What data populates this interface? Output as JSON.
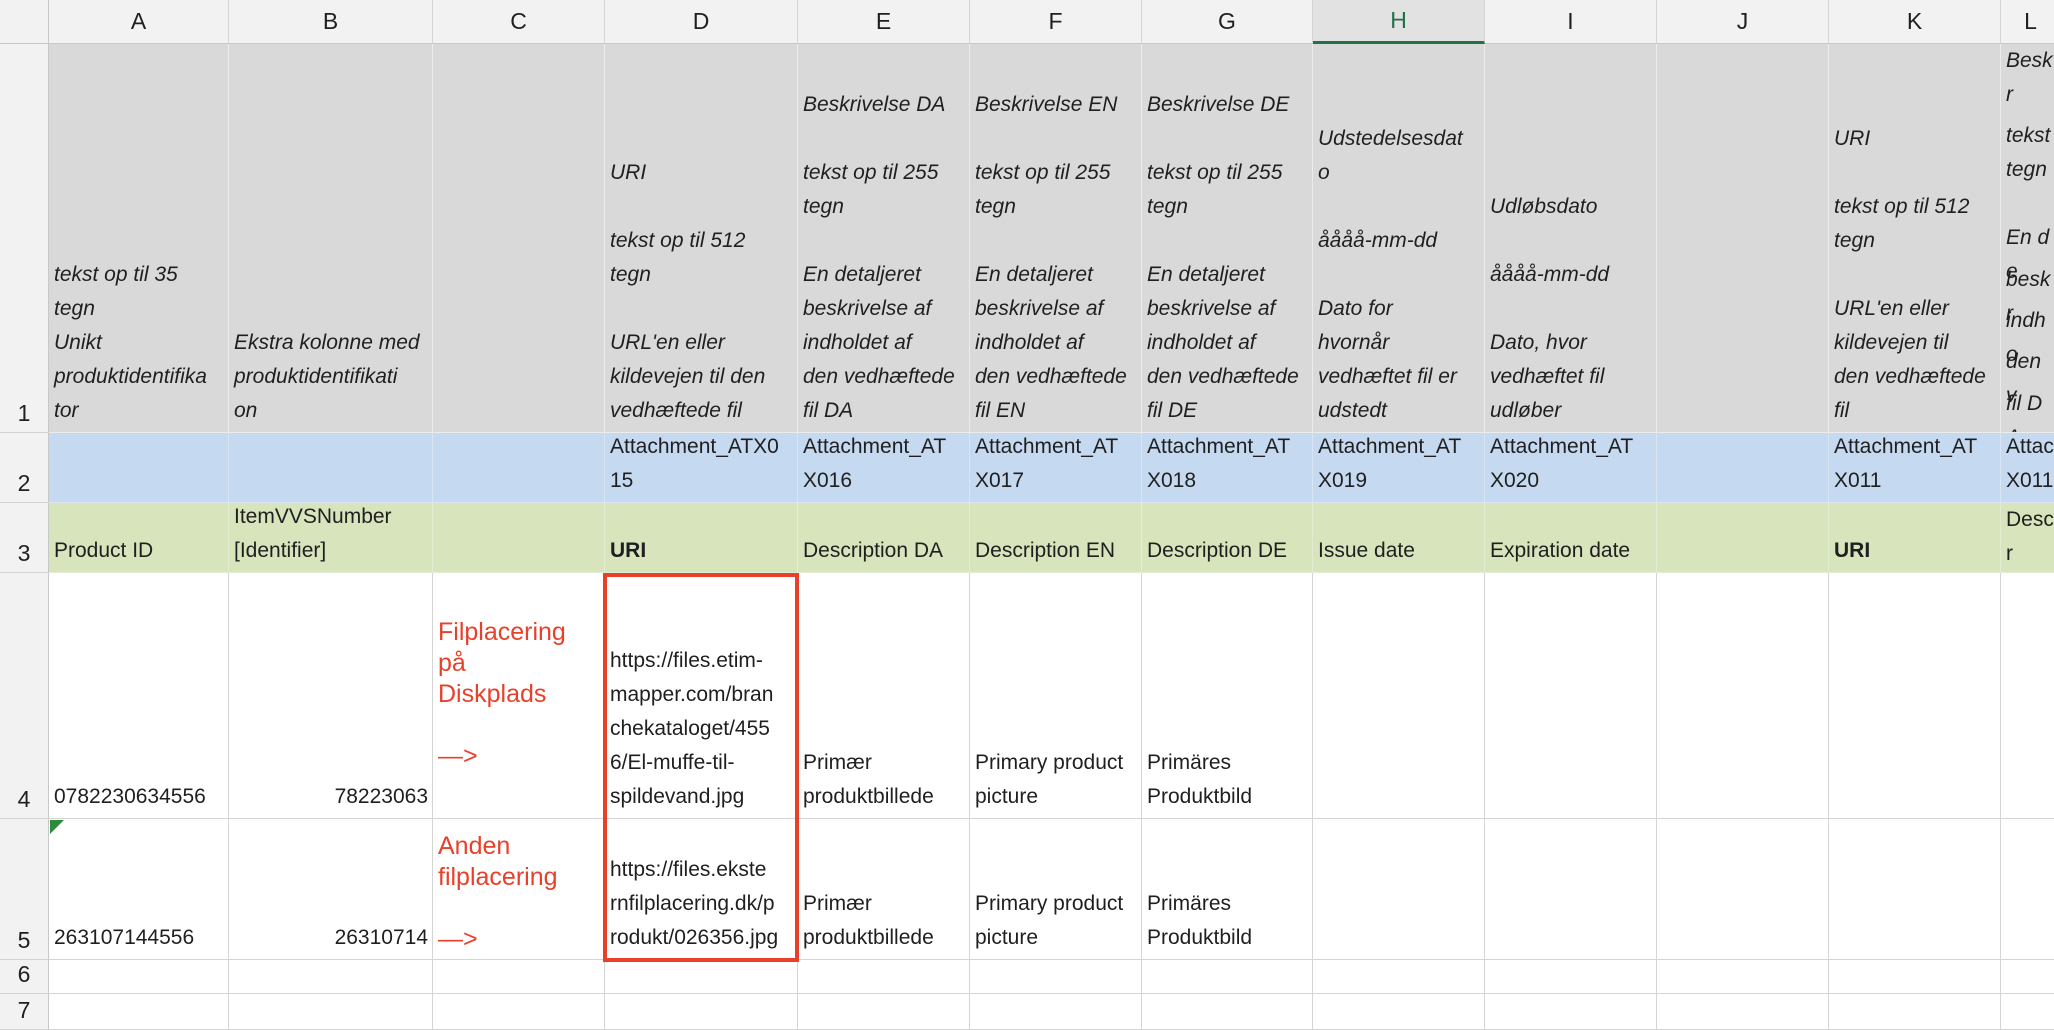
{
  "columns": [
    "A",
    "B",
    "C",
    "D",
    "E",
    "F",
    "G",
    "H",
    "I",
    "J",
    "K",
    "L"
  ],
  "selected_column": "H",
  "rows": [
    "1",
    "2",
    "3",
    "4",
    "5",
    "6",
    "7"
  ],
  "row1": {
    "A": [
      "tekst op til 35",
      "tegn",
      "Unikt",
      "produktidentifika",
      "tor"
    ],
    "B": [
      "Ekstra kolonne med",
      "produktidentifikati",
      "on"
    ],
    "C": [],
    "D": [
      "URI",
      "",
      "tekst op til 512",
      "tegn",
      "",
      "URL'en eller",
      "kildevejen til den",
      "vedhæftede fil"
    ],
    "E": [
      "Beskrivelse DA",
      "",
      "tekst op til 255",
      "tegn",
      "",
      "En detaljeret",
      "beskrivelse af",
      "indholdet af",
      "den vedhæftede",
      "fil DA"
    ],
    "F": [
      "Beskrivelse EN",
      "",
      "tekst op til 255",
      "tegn",
      "",
      "En detaljeret",
      "beskrivelse af",
      "indholdet af",
      "den vedhæftede",
      "fil EN"
    ],
    "G": [
      "Beskrivelse DE",
      "",
      "tekst op til 255",
      "tegn",
      "",
      "En detaljeret",
      "beskrivelse af",
      "indholdet af",
      "den vedhæftede",
      "fil DE"
    ],
    "H": [
      "Udstedelsesdat",
      "o",
      "",
      "åååå-mm-dd",
      "",
      "Dato for",
      "hvornår",
      "vedhæftet fil er",
      "udstedt"
    ],
    "I": [
      "Udløbsdato",
      "",
      "åååå-mm-dd",
      "",
      "Dato, hvor",
      "vedhæftet fil",
      "udløber"
    ],
    "J": [],
    "K": [
      "URI",
      "",
      "tekst op til 512",
      "tegn",
      "",
      "URL'en eller",
      "kildevejen til",
      "den vedhæftede",
      "fil"
    ],
    "L": [
      "Beskr",
      "",
      "tekst",
      "tegn",
      "",
      "En de",
      "beskr",
      "indho",
      "den v",
      "fil DA"
    ]
  },
  "row2": {
    "A": [],
    "B": [],
    "C": [],
    "D": [
      "Attachment_ATX0",
      "15"
    ],
    "E": [
      "Attachment_AT",
      "X016"
    ],
    "F": [
      "Attachment_AT",
      "X017"
    ],
    "G": [
      "Attachment_AT",
      "X018"
    ],
    "H": [
      "Attachment_AT",
      "X019"
    ],
    "I": [
      "Attachment_AT",
      "X020"
    ],
    "J": [],
    "K": [
      "Attachment_AT",
      "X011"
    ],
    "L": [
      "Attac",
      "X011"
    ]
  },
  "row3": {
    "A": [
      "Product ID"
    ],
    "B": [
      "ItemVVSNumber",
      "[Identifier]"
    ],
    "C": [],
    "D": [
      "URI"
    ],
    "E": [
      "Description DA"
    ],
    "F": [
      "Description EN"
    ],
    "G": [
      "Description DE"
    ],
    "H": [
      "Issue date"
    ],
    "I": [
      "Expiration date"
    ],
    "J": [],
    "K": [
      "URI"
    ],
    "L": [
      "Descr"
    ]
  },
  "row4": {
    "A": "0782230634556",
    "B": "78223063",
    "C": [
      "Filplacering",
      "på",
      "Diskplads",
      "",
      "—>"
    ],
    "D": [
      "https://files.etim-",
      "mapper.com/bran",
      "chekataloget/455",
      "6/El-muffe-til-",
      "spildevand.jpg"
    ],
    "E": [
      "Primær",
      "produktbillede"
    ],
    "F": [
      "Primary product",
      "picture"
    ],
    "G": [
      "Primäres",
      "Produktbild"
    ]
  },
  "row5": {
    "A": "263107144556",
    "B": "26310714",
    "C": [
      "Anden",
      "filplacering",
      "",
      "—>"
    ],
    "D": [
      "https://files.ekste",
      "rnfilplacering.dk/p",
      "rodukt/026356.jpg"
    ],
    "E": [
      "Primær",
      "produktbillede"
    ],
    "F": [
      "Primary product",
      "picture"
    ],
    "G": [
      "Primäres",
      "Produktbild"
    ]
  },
  "colors": {
    "header_row_fill": "#d9d9d9",
    "system_row_fill": "#c5d9f1",
    "field_row_fill": "#d7e4bc",
    "annotation_red": "#e8402a",
    "selected_column_accent": "#217346"
  }
}
